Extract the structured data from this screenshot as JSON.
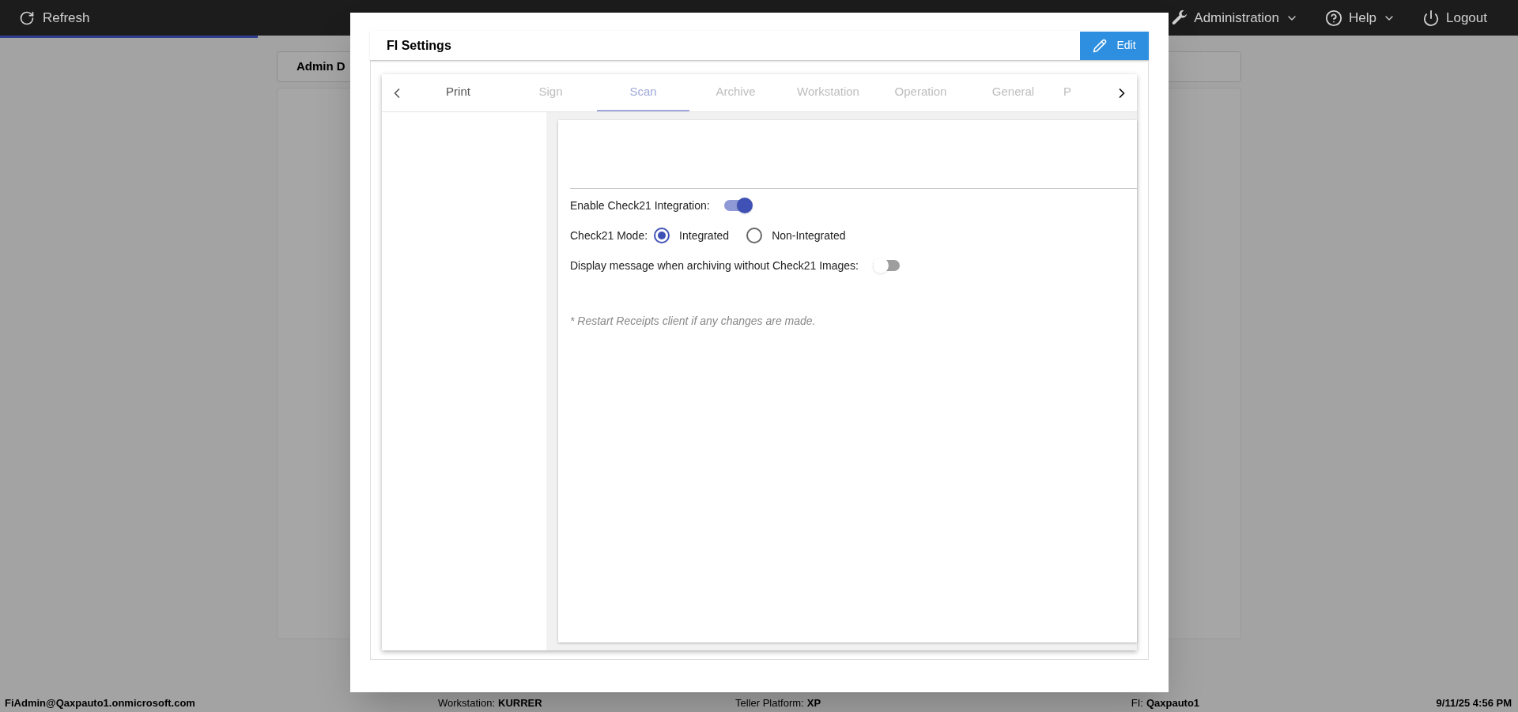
{
  "top_bar": {
    "refresh": "Refresh",
    "progress": {
      "level": 0.17
    },
    "menus": [
      {
        "label": "Administration",
        "dropdown": true
      },
      {
        "label": "Help",
        "dropdown": true
      },
      {
        "label": "Logout",
        "dropdown": false
      }
    ]
  },
  "background_card": {
    "title": "Admin D"
  },
  "dialog": {
    "title": "FI Settings",
    "edit_button": "Edit",
    "tabs": [
      {
        "label": "Print",
        "selected": false,
        "disabled": false
      },
      {
        "label": "Sign",
        "selected": false,
        "disabled": true
      },
      {
        "label": "Scan",
        "selected": true,
        "disabled": false
      },
      {
        "label": "Archive",
        "selected": false,
        "disabled": true
      },
      {
        "label": "Workstation",
        "selected": false,
        "disabled": true
      },
      {
        "label": "Operation",
        "selected": false,
        "disabled": true
      },
      {
        "label": "General",
        "selected": false,
        "disabled": true
      },
      {
        "label": "P",
        "selected": false,
        "disabled": true
      }
    ],
    "settings": [
      {
        "kind": "toggle",
        "label": "Enable Check21 Integration:",
        "on": true
      },
      {
        "kind": "radio",
        "label": "Check21 Mode:",
        "options": [
          {
            "label": "Integrated",
            "selected": true
          },
          {
            "label": "Non-Integrated",
            "selected": false
          }
        ]
      },
      {
        "kind": "toggle",
        "label": "Display message when archiving without Check21 Images:",
        "on": false
      }
    ],
    "note": "* Restart Receipts client if any changes are made."
  },
  "status_bar": {
    "user": "FiAdmin@Qaxpauto1.onmicrosoft.com",
    "workstation_label": "Workstation:",
    "workstation": "KURRER",
    "platform_label": "Teller Platform:",
    "platform": "XP",
    "fi_label": "FI:",
    "fi": "Qaxpauto1",
    "datetime": "9/11/25 4:56 PM"
  }
}
